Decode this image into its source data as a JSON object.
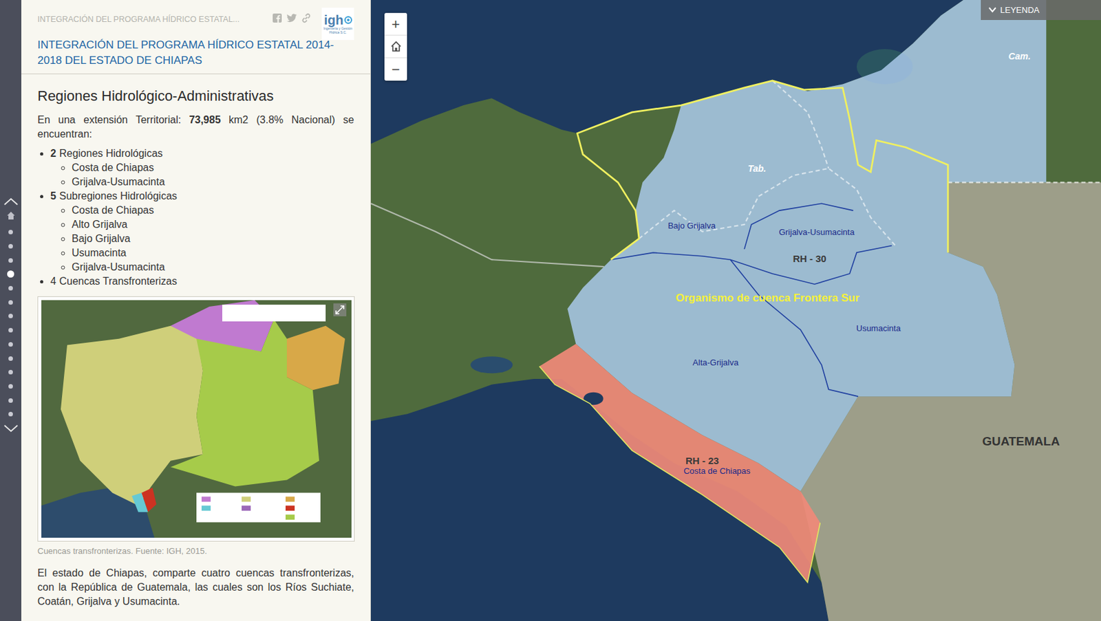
{
  "header": {
    "subtitle": "INTEGRACIÓN DEL PROGRAMA HÍDRICO ESTATAL...",
    "logo": {
      "mark": "igh",
      "caption": "Ingeniería y Gestión Hídrica S.C."
    },
    "title": "INTEGRACIÓN DEL PROGRAMA HÍDRICO ESTATAL 2014-2018 DEL ESTADO DE CHIAPAS"
  },
  "nav": {
    "dots": [
      {
        "selected": false
      },
      {
        "selected": false
      },
      {
        "selected": false
      },
      {
        "selected": true
      },
      {
        "selected": false
      },
      {
        "selected": false
      },
      {
        "selected": false
      },
      {
        "selected": false
      },
      {
        "selected": false
      },
      {
        "selected": false
      },
      {
        "selected": false
      },
      {
        "selected": false
      },
      {
        "selected": false
      },
      {
        "selected": false
      }
    ]
  },
  "section": {
    "heading": "Regiones Hidrológico-Administrativas",
    "intro": {
      "before": "En una extensión Territorial: ",
      "bold": "73,985",
      "after": " km2 (3.8% Nacional) se encuentran:"
    },
    "list": [
      {
        "count": "2",
        "count_bold": true,
        "label": "Regiones Hidrológicas",
        "items": [
          "Costa de Chiapas",
          "Grijalva-Usumacinta"
        ]
      },
      {
        "count": "5",
        "count_bold": true,
        "label": "Subregiones Hidrológicas",
        "items": [
          "Costa de Chiapas",
          "Alto Grijalva",
          "Bajo Grijalva",
          "Usumacinta",
          "Grijalva-Usumacinta"
        ]
      },
      {
        "count": "4",
        "count_bold": false,
        "label": "Cuencas Transfronterizas",
        "items": []
      }
    ],
    "caption": "Cuencas transfronterizas. Fuente: IGH, 2015.",
    "closing": "El estado de Chiapas, comparte cuatro cuencas transfronterizas, con la República de Guatemala, las cuales son los Ríos Suchiate, Coatán, Grijalva y Usumacinta."
  },
  "map": {
    "zoom_in": "+",
    "zoom_out": "−",
    "legend": {
      "label": "LEYENDA"
    },
    "labels": [
      {
        "text": "Cam.",
        "kind": "state"
      },
      {
        "text": "Tab.",
        "kind": "state"
      },
      {
        "text": "Bajo Grijalva",
        "kind": "subregion"
      },
      {
        "text": "Grijalva-Usumacinta",
        "kind": "subregion"
      },
      {
        "text": "RH - 30",
        "kind": "rh"
      },
      {
        "text": "Organismo de cuenca Frontera Sur",
        "kind": "organism"
      },
      {
        "text": "Usumacinta",
        "kind": "subregion"
      },
      {
        "text": "Alta-Grijalva",
        "kind": "subregion"
      },
      {
        "text": "RH - 23",
        "kind": "rh"
      },
      {
        "text": "Costa de Chiapas",
        "kind": "subregion"
      },
      {
        "text": "GUATEMALA",
        "kind": "country"
      }
    ]
  }
}
